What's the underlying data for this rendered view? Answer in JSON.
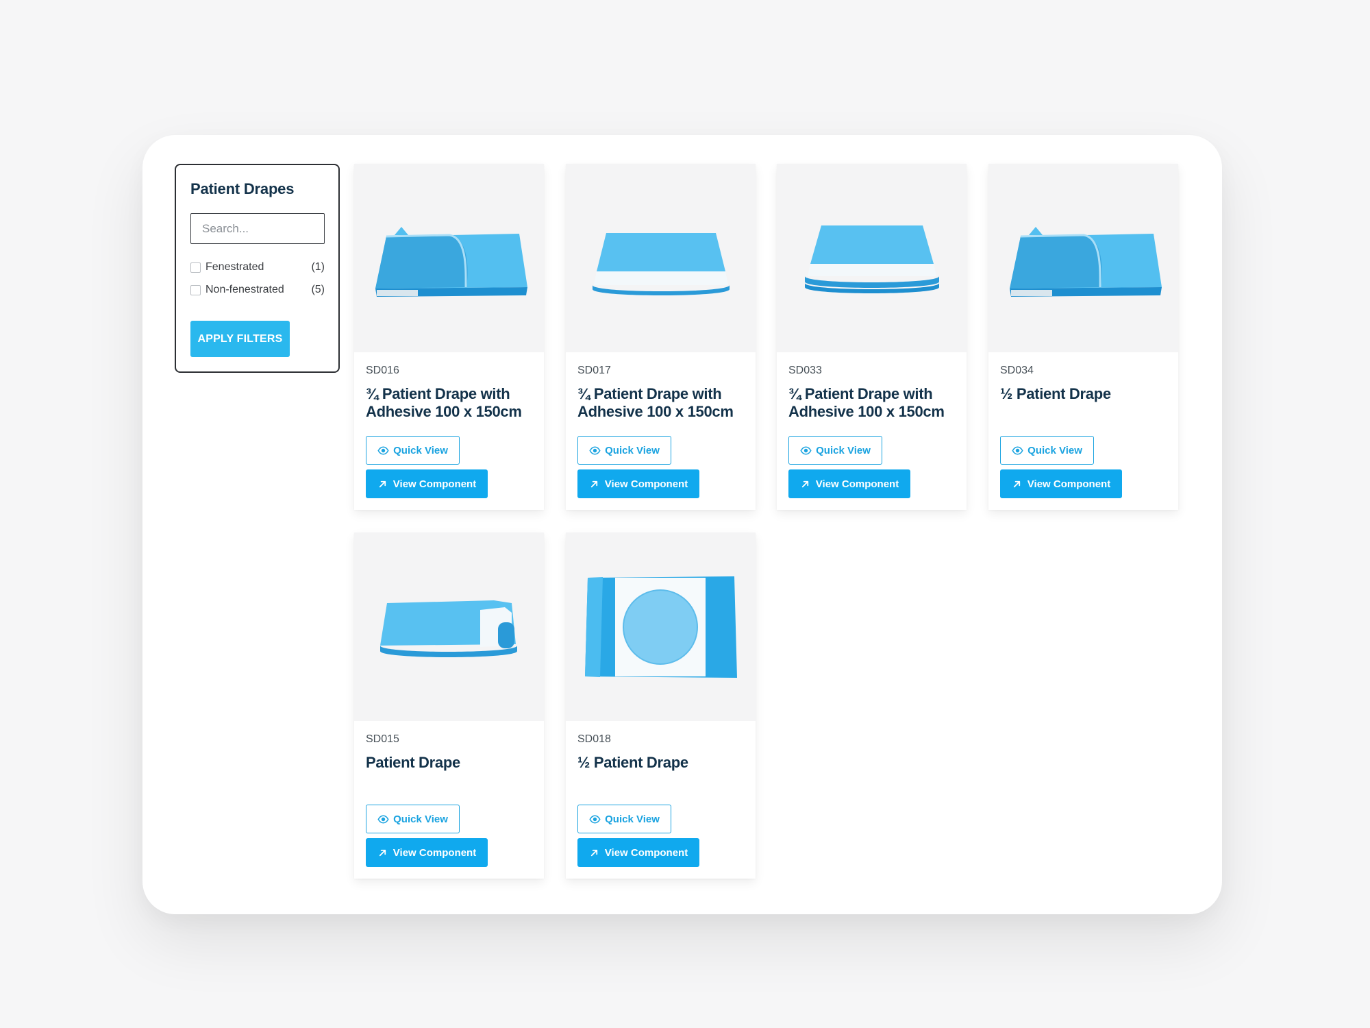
{
  "filter": {
    "title": "Patient Drapes",
    "search_placeholder": "Search...",
    "options": [
      {
        "label": "Fenestrated",
        "count": "(1)"
      },
      {
        "label": "Non-fenestrated",
        "count": "(5)"
      }
    ],
    "apply_label": "APPLY FILTERS"
  },
  "colors": {
    "accent": "#10a9ee",
    "apply_button": "#2ab8ee",
    "title_text": "#13324a",
    "drape_blue": "#3db2ea",
    "drape_light": "#a9def7"
  },
  "products": [
    {
      "code": "SD016",
      "title": "¾ Patient Drape with Adhesive 100 x 150cm",
      "image_icon": "folded-drape-fenestrated-corner",
      "quick_view_label": "Quick View",
      "view_component_label": "View Component"
    },
    {
      "code": "SD017",
      "title": "¾ Patient Drape with Adhesive 100 x 150cm",
      "image_icon": "folded-drape-white-band",
      "quick_view_label": "Quick View",
      "view_component_label": "View Component"
    },
    {
      "code": "SD033",
      "title": "¾ Patient Drape with Adhesive 100 x 150cm",
      "image_icon": "folded-drape-white-band-stacked",
      "quick_view_label": "Quick View",
      "view_component_label": "View Component"
    },
    {
      "code": "SD034",
      "title": "½ Patient Drape",
      "image_icon": "folded-drape-fenestrated-corner",
      "quick_view_label": "Quick View",
      "view_component_label": "View Component"
    },
    {
      "code": "SD015",
      "title": "Patient Drape",
      "image_icon": "folded-drape-rolled",
      "quick_view_label": "Quick View",
      "view_component_label": "View Component"
    },
    {
      "code": "SD018",
      "title": "½ Patient Drape",
      "image_icon": "flat-drape-circular-window",
      "quick_view_label": "Quick View",
      "view_component_label": "View Component"
    }
  ]
}
